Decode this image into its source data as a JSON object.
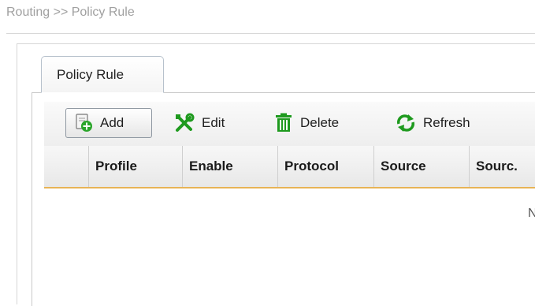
{
  "breadcrumb": "Routing >> Policy Rule",
  "tabs": [
    {
      "label": "Policy Rule",
      "active": true
    }
  ],
  "toolbar": {
    "add_label": "Add",
    "edit_label": "Edit",
    "delete_label": "Delete",
    "refresh_label": "Refresh"
  },
  "grid": {
    "columns": [
      "",
      "Profile",
      "Enable",
      "Protocol",
      "Source",
      "Sourc."
    ],
    "rows": [],
    "message_fragment": "N"
  },
  "colors": {
    "accent_underline": "#e8b355",
    "title_gray": "#a0a0a0",
    "icon_green": "#2aa52a"
  }
}
